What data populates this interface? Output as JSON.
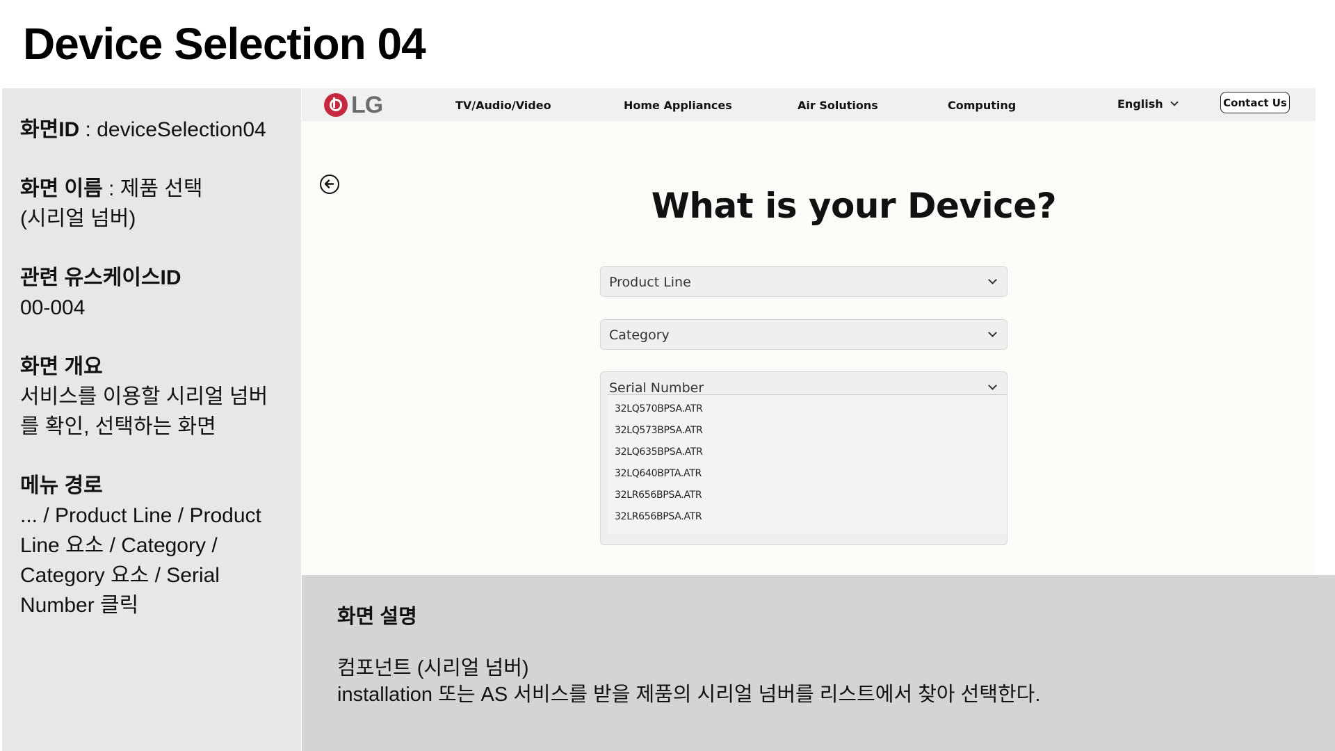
{
  "slide": {
    "title": "Device Selection 04"
  },
  "info": {
    "screen_id_label": "화면ID",
    "screen_id_value": " : deviceSelection04",
    "screen_name_label": "화면 이름",
    "screen_name_value_1": " : 제품 선택",
    "screen_name_value_2": "(시리얼 넘버)",
    "usecase_label": "관련 유스케이스ID",
    "usecase_value": "00-004",
    "overview_label": "화면 개요",
    "overview_value_1": "서비스를 이용할 시리얼 넘버",
    "overview_value_2": "를 확인, 선택하는 화면",
    "menu_label": "메뉴 경로",
    "menu_value_1": "... / Product Line / Product",
    "menu_value_2": "Line 요소 / Category /",
    "menu_value_3": "Category 요소 / Serial",
    "menu_value_4": "Number 클릭"
  },
  "navbar": {
    "logo_text": "LG",
    "items": [
      "TV/Audio/Video",
      "Home Appliances",
      "Air Solutions",
      "Computing"
    ],
    "language": "English",
    "contact_label": "Contact Us"
  },
  "main": {
    "heading": "What is your Device?",
    "product_line_label": "Product Line",
    "category_label": "Category",
    "serial_label": "Serial Number",
    "serial_options": [
      "32LQ570BPSA.ATR",
      "32LQ573BPSA.ATR",
      "32LQ635BPSA.ATR",
      "32LQ640BPTA.ATR",
      "32LR656BPSA.ATR",
      "32LR656BPSA.ATR"
    ]
  },
  "description": {
    "title": "화면 설명",
    "line1": "컴포넌트  (시리얼 넘버)",
    "line2": "installation 또는 AS 서비스를 받을 제품의 시리얼 넘버를 리스트에서 찾아 선택한다."
  },
  "colors": {
    "brand_red": "#c6283f",
    "panel_gray": "#e7e7e7",
    "desc_gray": "#d4d4d4"
  },
  "icons": [
    "lg-logo-icon",
    "chevron-down-icon",
    "back-arrow-icon"
  ]
}
